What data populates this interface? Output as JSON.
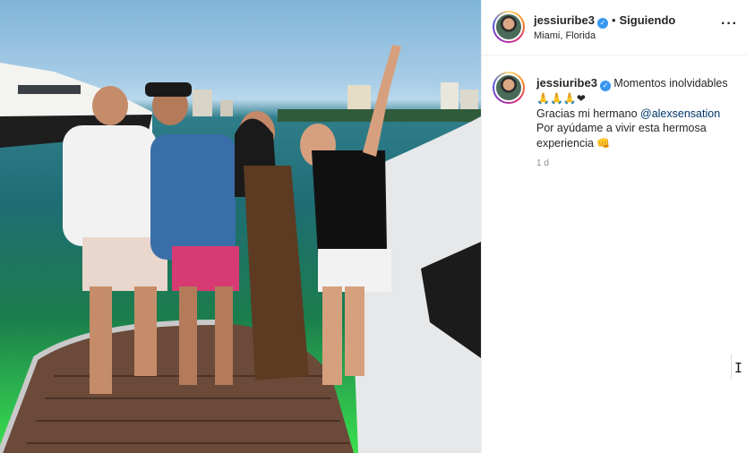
{
  "post": {
    "author": {
      "username": "jessiuribe3",
      "verified": true,
      "follow_separator": "•",
      "follow_status": "Siguiendo",
      "location": "Miami, Florida"
    },
    "more_icon": "more-horizontal-icon",
    "caption": {
      "username": "jessiuribe3",
      "text_line1": "Momentos inolvidables",
      "emojis_line2": "🙏🙏🙏❤",
      "text_line3_prefix": "Gracias mi hermano ",
      "mention": "@alexsensation",
      "text_line4": "Por ayúdame a vivir esta hermosa",
      "text_line5": "experiencia",
      "emoji_line5": "👊"
    },
    "timestamp": "1 d"
  },
  "colors": {
    "verified_badge": "#3897f0",
    "mention_link": "#00376b",
    "muted_text": "#8e8e8e"
  }
}
